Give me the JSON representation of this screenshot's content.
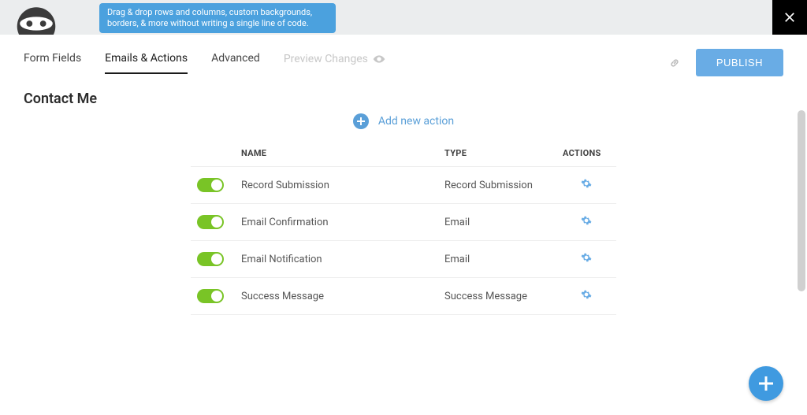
{
  "tooltip": "Drag & drop rows and columns, custom backgrounds, borders, & more without writing a single line of code.",
  "tabs": {
    "form_fields": "Form Fields",
    "emails_actions": "Emails & Actions",
    "advanced": "Advanced",
    "preview": "Preview Changes"
  },
  "publish_label": "PUBLISH",
  "page_title": "Contact Me",
  "add_action_label": "Add new action",
  "columns": {
    "name": "NAME",
    "type": "TYPE",
    "actions": "ACTIONS"
  },
  "rows": [
    {
      "name": "Record Submission",
      "type": "Record Submission",
      "enabled": true
    },
    {
      "name": "Email Confirmation",
      "type": "Email",
      "enabled": true
    },
    {
      "name": "Email Notification",
      "type": "Email",
      "enabled": true
    },
    {
      "name": "Success Message",
      "type": "Success Message",
      "enabled": true
    }
  ]
}
